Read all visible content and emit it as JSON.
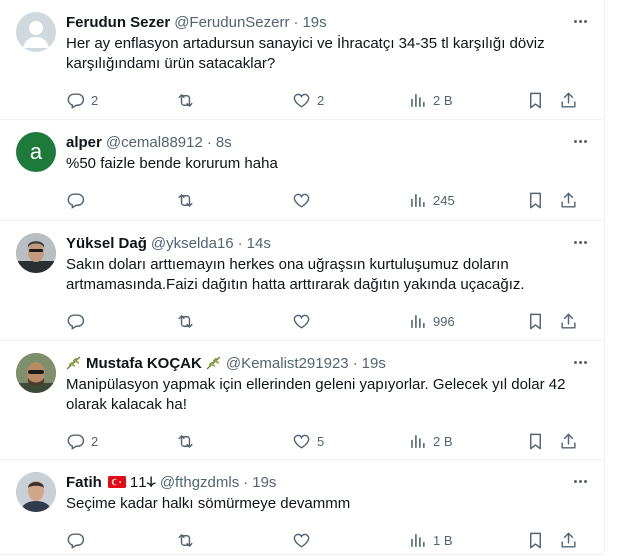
{
  "tweets": [
    {
      "name": "Ferudun Sezer",
      "handle": "@FerudunSezerr",
      "time": "19s",
      "text": "Her ay enflasyon artadursun sanayici ve İhracatçı 34-35 tl karşılığı döviz karşılığındamı ürün satacaklar?",
      "replies": "2",
      "retweets": "",
      "likes": "2",
      "views": "2 B",
      "avatar": "default-avatar"
    },
    {
      "name": "alper",
      "handle": "@cemal88912",
      "time": "8s",
      "text": "%50 faizle bende korurum haha",
      "replies": "",
      "retweets": "",
      "likes": "",
      "views": "245",
      "avatar_letter": "a",
      "avatar_color": "#1e7a3a"
    },
    {
      "name": "Yüksel Dağ",
      "handle": "@ykselda16",
      "time": "14s",
      "text": "Sakın doları arttıemayın herkes ona uğraşsın kurtuluşumuz doların artmamasında.Faizi dağıtın hatta arttırarak dağıtın yakında uçacağız.",
      "replies": "",
      "retweets": "",
      "likes": "",
      "views": "996",
      "avatar": "photo-avatar"
    },
    {
      "name": "Mustafa KOÇAK",
      "handle": "@Kemalist291923",
      "time": "19s",
      "text": "Manipülasyon yapmak için ellerinden geleni yapıyorlar. Gelecek yıl dolar 42 olarak kalacak ha!",
      "replies": "2",
      "retweets": "",
      "likes": "5",
      "views": "2 B",
      "avatar": "photo-avatar"
    },
    {
      "name": "Fatih",
      "name_suffix": "1𐰸1",
      "handle": "@fthgzdmls",
      "time": "19s",
      "text": "Seçime kadar halkı sömürmeye devammm",
      "replies": "",
      "retweets": "",
      "likes": "",
      "views": "1 B",
      "avatar": "photo-avatar"
    }
  ],
  "colors": {
    "meta": "#536471",
    "text": "#0f1419",
    "divider": "#eff3f4",
    "flag_red": "#e30a17"
  },
  "icons": [
    "more-icon",
    "reply-icon",
    "retweet-icon",
    "like-icon",
    "views-icon",
    "bookmark-icon",
    "share-icon",
    "olive-branch-icon",
    "turkey-flag-icon"
  ]
}
